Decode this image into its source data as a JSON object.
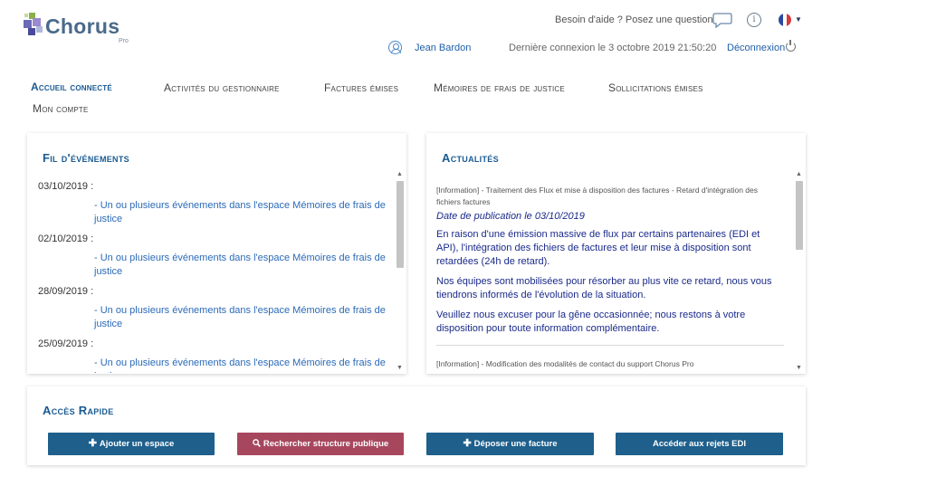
{
  "brand": {
    "name": "Chorus",
    "sub": "Pro"
  },
  "header": {
    "help_text": "Besoin d'aide ? Posez une question",
    "user_name": "Jean Bardon",
    "last_login": "Dernière connexion le 3 octobre 2019 21:50:20",
    "logout_label": "Déconnexion"
  },
  "nav": [
    {
      "label": "Accueil connecté"
    },
    {
      "label": "Activités du gestionnaire"
    },
    {
      "label": "Factures émises"
    },
    {
      "label": "Mémoires de frais de justice"
    },
    {
      "label": "Sollicitations émises"
    },
    {
      "label": "Mon compte"
    }
  ],
  "events_panel": {
    "title": "Fil d'événements",
    "items": [
      {
        "date": "03/10/2019 :",
        "text": "- Un ou plusieurs événements dans l'espace Mémoires de frais de justice"
      },
      {
        "date": "02/10/2019 :",
        "text": "- Un ou plusieurs événements dans l'espace Mémoires de frais de justice"
      },
      {
        "date": "28/09/2019 :",
        "text": "- Un ou plusieurs événements dans l'espace Mémoires de frais de justice"
      },
      {
        "date": "25/09/2019 :",
        "text": "- Un ou plusieurs événements dans l'espace Mémoires de frais de justice"
      }
    ]
  },
  "news_panel": {
    "title": "Actualités",
    "item1": {
      "heading": "[Information] - Traitement des Flux et mise à disposition des factures - Retard d'intégration des fichiers factures",
      "date": "Date de publication le 03/10/2019",
      "p1": "En raison d'une émission massive de flux par certains partenaires (EDI et API), l'intégration des fichiers de factures et leur mise à disposition sont retardées (24h de retard).",
      "p2": "Nos équipes sont mobilisées pour résorber au plus vite ce retard, nous vous tiendrons informés de l'évolution de la situation.",
      "p3": "Veuillez nous excuser pour la gêne occasionnée; nous restons à votre disposition pour toute information complémentaire."
    },
    "item2": {
      "heading": "[Information] - Modification des modalités de contact du support Chorus Pro"
    }
  },
  "quick_access": {
    "title": "Accès Rapide",
    "buttons": [
      {
        "label": "Ajouter un espace",
        "icon": "plus-icon"
      },
      {
        "label": "Rechercher structure publique",
        "icon": "search-icon"
      },
      {
        "label": "Déposer une facture",
        "icon": "plus-icon"
      },
      {
        "label": "Accéder aux rejets EDI",
        "icon": ""
      }
    ]
  },
  "colors": {
    "primary": "#1e5f8c",
    "secondary_button": "#a7475e",
    "link": "#2a6ab8",
    "news_text": "#1a2a8a",
    "title": "#1a5a92"
  }
}
